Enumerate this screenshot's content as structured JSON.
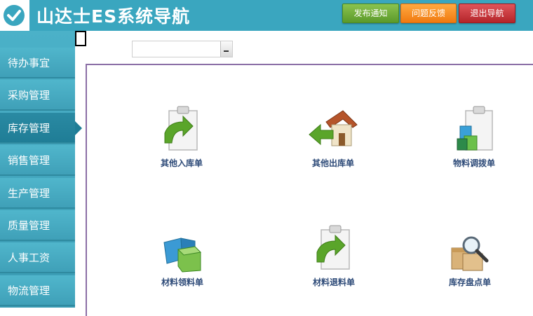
{
  "header": {
    "title": "山达士ES系统导航",
    "buttons": {
      "publish": "发布通知",
      "feedback": "问题反馈",
      "exit": "退出导航"
    }
  },
  "sidebar": {
    "items": [
      {
        "label": "待办事宜"
      },
      {
        "label": "采购管理"
      },
      {
        "label": "库存管理",
        "active": true
      },
      {
        "label": "销售管理"
      },
      {
        "label": "生产管理"
      },
      {
        "label": "质量管理"
      },
      {
        "label": "人事工资"
      },
      {
        "label": "物流管理"
      }
    ]
  },
  "dropdown": {
    "value": ""
  },
  "tiles": [
    {
      "label": "其他入库单",
      "icon": "clipboard-arrow-in-icon"
    },
    {
      "label": "其他出库单",
      "icon": "house-arrow-out-icon"
    },
    {
      "label": "物料调拨单",
      "icon": "clipboard-bins-icon"
    },
    {
      "label": "材料领料单",
      "icon": "bins-icon"
    },
    {
      "label": "材料退料单",
      "icon": "clipboard-arrow-return-icon"
    },
    {
      "label": "库存盘点单",
      "icon": "box-magnifier-icon"
    }
  ],
  "colors": {
    "header_bg": "#3aa6bf",
    "sidebar_active": "#1f7d96",
    "label_text": "#2d4a78"
  }
}
